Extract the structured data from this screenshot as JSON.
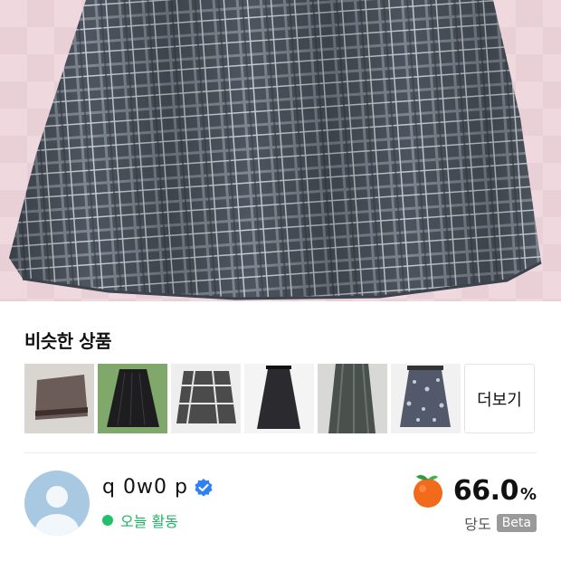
{
  "similar": {
    "title": "비슷한 상품",
    "thumbnails": [
      {
        "name": "thumb-brown-mini-skirt"
      },
      {
        "name": "thumb-black-pleated-skirt"
      },
      {
        "name": "thumb-plaid-skirt"
      },
      {
        "name": "thumb-black-midi-skirt"
      },
      {
        "name": "thumb-grey-long-skirt"
      },
      {
        "name": "thumb-patterned-skirt"
      }
    ],
    "more_label": "더보기"
  },
  "seller": {
    "name": "q 0w0 p",
    "activity": "오늘 활동",
    "score": "66.0",
    "score_unit": "%",
    "score_label": "당도",
    "badge": "Beta"
  },
  "colors": {
    "activity_green": "#1fc26a",
    "avatar_bg": "#a9c9e2",
    "verified_blue": "#2f7ff5",
    "orange": "#f26a1b"
  },
  "icons": {
    "verified": "verified-check-icon",
    "score": "orange-fruit-icon",
    "avatar": "default-user-avatar-icon"
  }
}
